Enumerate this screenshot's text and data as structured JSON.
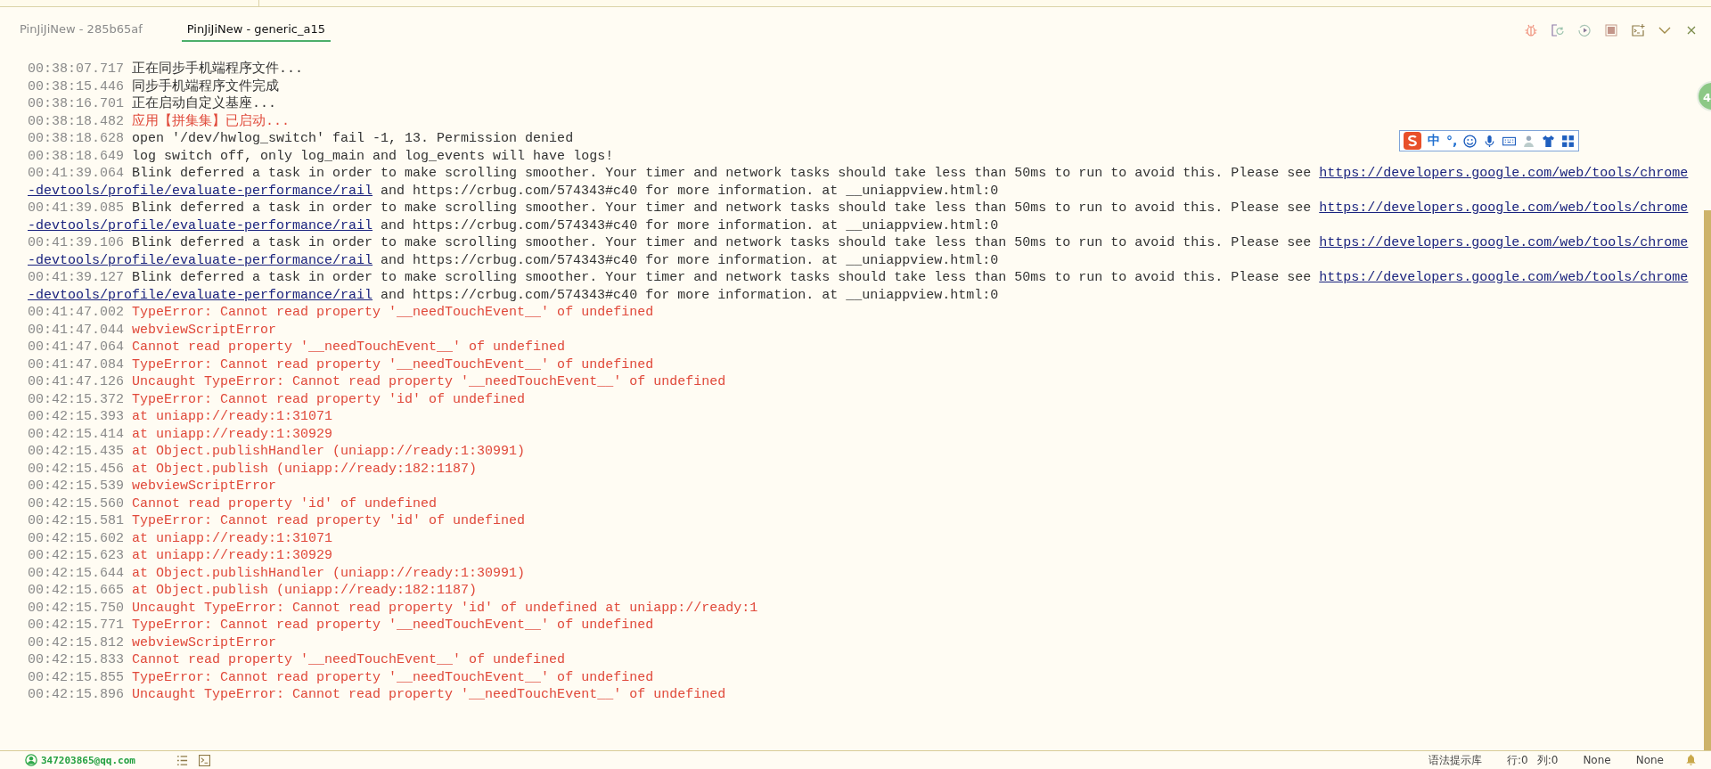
{
  "tabs": [
    {
      "label": "PinJiJiNew - 285b65af",
      "selected": false
    },
    {
      "label": "PinJiJiNew - generic_a15",
      "selected": true
    }
  ],
  "log": [
    {
      "time": "00:38:07.717",
      "color": "#333333",
      "text": "正在同步手机端程序文件..."
    },
    {
      "time": "00:38:15.446",
      "color": "#333333",
      "text": "同步手机端程序文件完成"
    },
    {
      "time": "00:38:16.701",
      "color": "#333333",
      "text": "正在启动自定义基座..."
    },
    {
      "time": "00:38:18.482",
      "color": "#e0493a",
      "text": "应用【拼集集】已启动..."
    },
    {
      "time": "00:38:18.628",
      "color": "#333333",
      "text": "open '/dev/hwlog_switch' fail -1, 13. Permission denied"
    },
    {
      "time": "00:38:18.649",
      "color": "#333333",
      "text": "log switch off, only log_main and log_events will have logs!"
    },
    {
      "time": "00:41:39.064",
      "color": "#333333",
      "lines": [
        [
          {
            "kind": "text",
            "text": "Blink deferred a task in order to make scrolling smoother. Your timer and network tasks should take less than 50ms to run to avoid this. Please see "
          },
          {
            "kind": "link",
            "text": "https://developers.google.com/web/tools/chrome"
          }
        ],
        [
          {
            "kind": "link",
            "text": "-devtools/profile/evaluate-performance/rail"
          },
          {
            "kind": "text",
            "text": " and https://crbug.com/574343#c40 for more information. at __uniappview.html:0"
          }
        ]
      ]
    },
    {
      "time": "00:41:39.085",
      "color": "#333333",
      "lines": [
        [
          {
            "kind": "text",
            "text": "Blink deferred a task in order to make scrolling smoother. Your timer and network tasks should take less than 50ms to run to avoid this. Please see "
          },
          {
            "kind": "link",
            "text": "https://developers.google.com/web/tools/chrome"
          }
        ],
        [
          {
            "kind": "link",
            "text": "-devtools/profile/evaluate-performance/rail"
          },
          {
            "kind": "text",
            "text": " and https://crbug.com/574343#c40 for more information. at __uniappview.html:0"
          }
        ]
      ]
    },
    {
      "time": "00:41:39.106",
      "color": "#333333",
      "lines": [
        [
          {
            "kind": "text",
            "text": "Blink deferred a task in order to make scrolling smoother. Your timer and network tasks should take less than 50ms to run to avoid this. Please see "
          },
          {
            "kind": "link",
            "text": "https://developers.google.com/web/tools/chrome"
          }
        ],
        [
          {
            "kind": "link",
            "text": "-devtools/profile/evaluate-performance/rail"
          },
          {
            "kind": "text",
            "text": " and https://crbug.com/574343#c40 for more information. at __uniappview.html:0"
          }
        ]
      ]
    },
    {
      "time": "00:41:39.127",
      "color": "#333333",
      "lines": [
        [
          {
            "kind": "text",
            "text": "Blink deferred a task in order to make scrolling smoother. Your timer and network tasks should take less than 50ms to run to avoid this. Please see "
          },
          {
            "kind": "link",
            "text": "https://developers.google.com/web/tools/chrome"
          }
        ],
        [
          {
            "kind": "link",
            "text": "-devtools/profile/evaluate-performance/rail"
          },
          {
            "kind": "text",
            "text": " and https://crbug.com/574343#c40 for more information. at __uniappview.html:0"
          }
        ]
      ]
    },
    {
      "time": "00:41:47.002",
      "color": "#e0493a",
      "text": "TypeError: Cannot read property '__needTouchEvent__' of undefined"
    },
    {
      "time": "00:41:47.044",
      "color": "#e0493a",
      "text": "webviewScriptError"
    },
    {
      "time": "00:41:47.064",
      "color": "#e0493a",
      "text": "Cannot read property '__needTouchEvent__' of undefined"
    },
    {
      "time": "00:41:47.084",
      "color": "#e0493a",
      "text": "TypeError: Cannot read property '__needTouchEvent__' of undefined"
    },
    {
      "time": "00:41:47.126",
      "color": "#e0493a",
      "text": "Uncaught TypeError: Cannot read property '__needTouchEvent__' of undefined"
    },
    {
      "time": "00:42:15.372",
      "color": "#e0493a",
      "text": "TypeError: Cannot read property 'id' of undefined"
    },
    {
      "time": "00:42:15.393",
      "color": "#e0493a",
      "text": "at uniapp://ready:1:31071"
    },
    {
      "time": "00:42:15.414",
      "color": "#e0493a",
      "text": "at uniapp://ready:1:30929"
    },
    {
      "time": "00:42:15.435",
      "color": "#e0493a",
      "text": "at Object.publishHandler (uniapp://ready:1:30991)"
    },
    {
      "time": "00:42:15.456",
      "color": "#e0493a",
      "text": "at Object.publish (uniapp://ready:182:1187)"
    },
    {
      "time": "00:42:15.539",
      "color": "#e0493a",
      "text": "webviewScriptError"
    },
    {
      "time": "00:42:15.560",
      "color": "#e0493a",
      "text": "Cannot read property 'id' of undefined"
    },
    {
      "time": "00:42:15.581",
      "color": "#e0493a",
      "text": "TypeError: Cannot read property 'id' of undefined"
    },
    {
      "time": "00:42:15.602",
      "color": "#e0493a",
      "text": "at uniapp://ready:1:31071"
    },
    {
      "time": "00:42:15.623",
      "color": "#e0493a",
      "text": "at uniapp://ready:1:30929"
    },
    {
      "time": "00:42:15.644",
      "color": "#e0493a",
      "text": "at Object.publishHandler (uniapp://ready:1:30991)"
    },
    {
      "time": "00:42:15.665",
      "color": "#e0493a",
      "text": "at Object.publish (uniapp://ready:182:1187)"
    },
    {
      "time": "00:42:15.750",
      "color": "#e0493a",
      "text": "Uncaught TypeError: Cannot read property 'id' of undefined at uniapp://ready:1"
    },
    {
      "time": "00:42:15.771",
      "color": "#e0493a",
      "text": "TypeError: Cannot read property '__needTouchEvent__' of undefined"
    },
    {
      "time": "00:42:15.812",
      "color": "#e0493a",
      "text": "webviewScriptError"
    },
    {
      "time": "00:42:15.833",
      "color": "#e0493a",
      "text": "Cannot read property '__needTouchEvent__' of undefined"
    },
    {
      "time": "00:42:15.855",
      "color": "#e0493a",
      "text": "TypeError: Cannot read property '__needTouchEvent__' of undefined"
    },
    {
      "time": "00:42:15.896",
      "color": "#e0493a",
      "text": "Uncaught TypeError: Cannot read property '__needTouchEvent__' of undefined"
    }
  ],
  "ime_toolbar": {
    "mode": "中",
    "punctuation": "°,"
  },
  "floating_badge": {
    "text": "4"
  },
  "status_bar": {
    "account": "347203865@qq.com",
    "syntax": "语法提示库",
    "row": "行:0",
    "column": "列:0",
    "encoding": "None",
    "language": "None"
  }
}
